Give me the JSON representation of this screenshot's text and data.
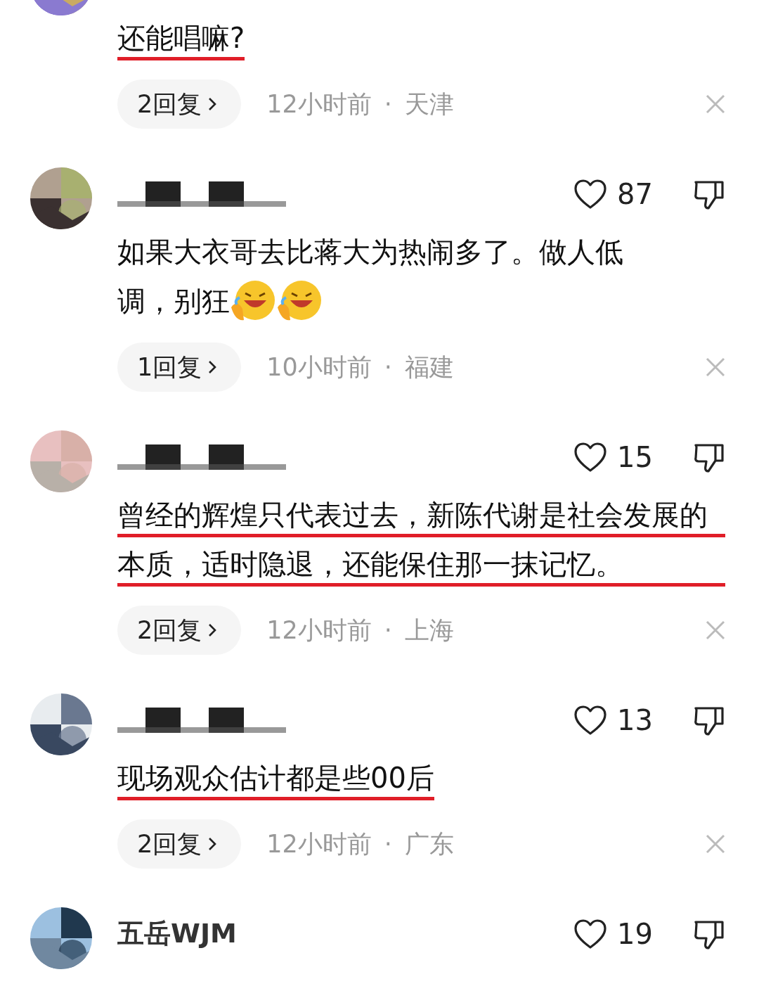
{
  "comments": [
    {
      "text": "还能唱嘛?",
      "marked": true,
      "replies": "2回复",
      "time": "12小时前",
      "location": "天津",
      "separator": "·"
    },
    {
      "name_redacted": true,
      "likes": "87",
      "lines": [
        "如果大衣哥去比蒋大为热闹多了。做人低",
        "调，别狂"
      ],
      "emojis": [
        {
          "kind": "laugh"
        },
        {
          "kind": "laugh"
        }
      ],
      "marked": false,
      "replies": "1回复",
      "time": "10小时前",
      "location": "福建",
      "separator": "·"
    },
    {
      "name_redacted": true,
      "likes": "15",
      "text": "曾经的辉煌只代表过去，新陈代谢是社会发展的本质，适时隐退，还能保住那一抹记忆。",
      "marked": true,
      "replies": "2回复",
      "time": "12小时前",
      "location": "上海",
      "separator": "·"
    },
    {
      "name_redacted": true,
      "likes": "13",
      "text": "现场观众估计都是些00后",
      "marked": true,
      "replies": "2回复",
      "time": "12小时前",
      "location": "广东",
      "separator": "·"
    },
    {
      "username": "五岳WJM",
      "likes": "19"
    }
  ]
}
